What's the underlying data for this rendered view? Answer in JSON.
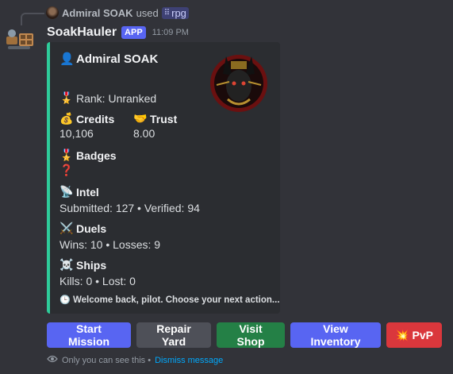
{
  "reply": {
    "username": "Admiral SOAK",
    "used_text": "used",
    "command": "rpg"
  },
  "message": {
    "bot_name": "SoakHauler",
    "badge": "APP",
    "timestamp": "11:09 PM"
  },
  "embed": {
    "accent_color": "#2ecc9a",
    "author_emoji": "👤",
    "author": "Admiral SOAK",
    "rank_emoji": "🎖️",
    "rank": "Rank: Unranked",
    "credits_emoji": "💰",
    "credits_label": "Credits",
    "credits_value": "10,106",
    "trust_emoji": "🤝",
    "trust_label": "Trust",
    "trust_value": "8.00",
    "badges_emoji": "🎖️",
    "badges_label": "Badges",
    "badges_value": "❓",
    "intel_emoji": "📡",
    "intel_label": "Intel",
    "intel_value": "Submitted: 127 • Verified: 94",
    "duels_emoji": "⚔️",
    "duels_label": "Duels",
    "duels_value": "Wins: 10 • Losses: 9",
    "ships_emoji": "☠️",
    "ships_label": "Ships",
    "ships_value": "Kills: 0 • Lost: 0",
    "footer_emoji": "🕒",
    "footer": "Welcome back, pilot. Choose your next action..."
  },
  "buttons": {
    "start_mission": "Start Mission",
    "repair_yard": "Repair Yard",
    "visit_shop": "Visit Shop",
    "view_inventory": "View Inventory",
    "pvp_emoji": "💥",
    "pvp": "PvP"
  },
  "ephemeral": {
    "notice": "Only you can see this •",
    "dismiss": "Dismiss message"
  },
  "colors": {
    "background": "#323339",
    "primary": "#5865f2",
    "secondary": "#4e5058",
    "success": "#248046",
    "danger": "#da373c",
    "link": "#00a8fc"
  }
}
